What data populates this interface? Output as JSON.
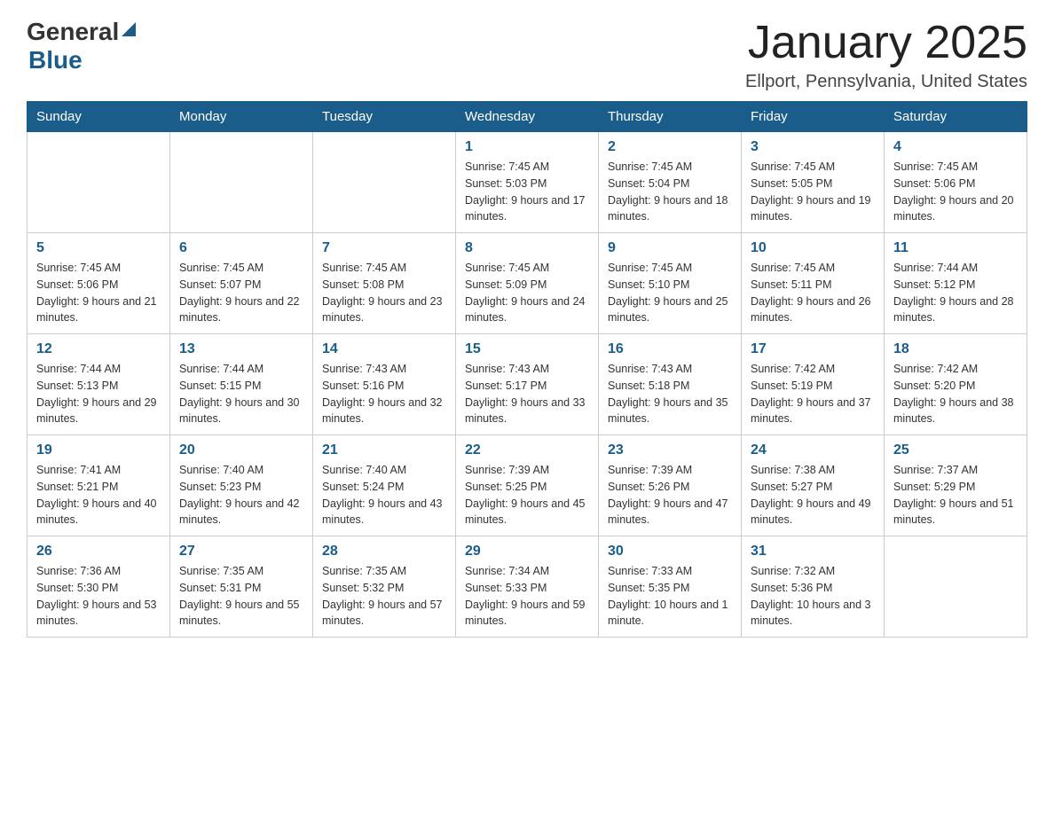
{
  "logo": {
    "general": "General",
    "blue": "Blue"
  },
  "header": {
    "title": "January 2025",
    "location": "Ellport, Pennsylvania, United States"
  },
  "days_of_week": [
    "Sunday",
    "Monday",
    "Tuesday",
    "Wednesday",
    "Thursday",
    "Friday",
    "Saturday"
  ],
  "weeks": [
    [
      {
        "day": "",
        "info": ""
      },
      {
        "day": "",
        "info": ""
      },
      {
        "day": "",
        "info": ""
      },
      {
        "day": "1",
        "info": "Sunrise: 7:45 AM\nSunset: 5:03 PM\nDaylight: 9 hours\nand 17 minutes."
      },
      {
        "day": "2",
        "info": "Sunrise: 7:45 AM\nSunset: 5:04 PM\nDaylight: 9 hours\nand 18 minutes."
      },
      {
        "day": "3",
        "info": "Sunrise: 7:45 AM\nSunset: 5:05 PM\nDaylight: 9 hours\nand 19 minutes."
      },
      {
        "day": "4",
        "info": "Sunrise: 7:45 AM\nSunset: 5:06 PM\nDaylight: 9 hours\nand 20 minutes."
      }
    ],
    [
      {
        "day": "5",
        "info": "Sunrise: 7:45 AM\nSunset: 5:06 PM\nDaylight: 9 hours\nand 21 minutes."
      },
      {
        "day": "6",
        "info": "Sunrise: 7:45 AM\nSunset: 5:07 PM\nDaylight: 9 hours\nand 22 minutes."
      },
      {
        "day": "7",
        "info": "Sunrise: 7:45 AM\nSunset: 5:08 PM\nDaylight: 9 hours\nand 23 minutes."
      },
      {
        "day": "8",
        "info": "Sunrise: 7:45 AM\nSunset: 5:09 PM\nDaylight: 9 hours\nand 24 minutes."
      },
      {
        "day": "9",
        "info": "Sunrise: 7:45 AM\nSunset: 5:10 PM\nDaylight: 9 hours\nand 25 minutes."
      },
      {
        "day": "10",
        "info": "Sunrise: 7:45 AM\nSunset: 5:11 PM\nDaylight: 9 hours\nand 26 minutes."
      },
      {
        "day": "11",
        "info": "Sunrise: 7:44 AM\nSunset: 5:12 PM\nDaylight: 9 hours\nand 28 minutes."
      }
    ],
    [
      {
        "day": "12",
        "info": "Sunrise: 7:44 AM\nSunset: 5:13 PM\nDaylight: 9 hours\nand 29 minutes."
      },
      {
        "day": "13",
        "info": "Sunrise: 7:44 AM\nSunset: 5:15 PM\nDaylight: 9 hours\nand 30 minutes."
      },
      {
        "day": "14",
        "info": "Sunrise: 7:43 AM\nSunset: 5:16 PM\nDaylight: 9 hours\nand 32 minutes."
      },
      {
        "day": "15",
        "info": "Sunrise: 7:43 AM\nSunset: 5:17 PM\nDaylight: 9 hours\nand 33 minutes."
      },
      {
        "day": "16",
        "info": "Sunrise: 7:43 AM\nSunset: 5:18 PM\nDaylight: 9 hours\nand 35 minutes."
      },
      {
        "day": "17",
        "info": "Sunrise: 7:42 AM\nSunset: 5:19 PM\nDaylight: 9 hours\nand 37 minutes."
      },
      {
        "day": "18",
        "info": "Sunrise: 7:42 AM\nSunset: 5:20 PM\nDaylight: 9 hours\nand 38 minutes."
      }
    ],
    [
      {
        "day": "19",
        "info": "Sunrise: 7:41 AM\nSunset: 5:21 PM\nDaylight: 9 hours\nand 40 minutes."
      },
      {
        "day": "20",
        "info": "Sunrise: 7:40 AM\nSunset: 5:23 PM\nDaylight: 9 hours\nand 42 minutes."
      },
      {
        "day": "21",
        "info": "Sunrise: 7:40 AM\nSunset: 5:24 PM\nDaylight: 9 hours\nand 43 minutes."
      },
      {
        "day": "22",
        "info": "Sunrise: 7:39 AM\nSunset: 5:25 PM\nDaylight: 9 hours\nand 45 minutes."
      },
      {
        "day": "23",
        "info": "Sunrise: 7:39 AM\nSunset: 5:26 PM\nDaylight: 9 hours\nand 47 minutes."
      },
      {
        "day": "24",
        "info": "Sunrise: 7:38 AM\nSunset: 5:27 PM\nDaylight: 9 hours\nand 49 minutes."
      },
      {
        "day": "25",
        "info": "Sunrise: 7:37 AM\nSunset: 5:29 PM\nDaylight: 9 hours\nand 51 minutes."
      }
    ],
    [
      {
        "day": "26",
        "info": "Sunrise: 7:36 AM\nSunset: 5:30 PM\nDaylight: 9 hours\nand 53 minutes."
      },
      {
        "day": "27",
        "info": "Sunrise: 7:35 AM\nSunset: 5:31 PM\nDaylight: 9 hours\nand 55 minutes."
      },
      {
        "day": "28",
        "info": "Sunrise: 7:35 AM\nSunset: 5:32 PM\nDaylight: 9 hours\nand 57 minutes."
      },
      {
        "day": "29",
        "info": "Sunrise: 7:34 AM\nSunset: 5:33 PM\nDaylight: 9 hours\nand 59 minutes."
      },
      {
        "day": "30",
        "info": "Sunrise: 7:33 AM\nSunset: 5:35 PM\nDaylight: 10 hours\nand 1 minute."
      },
      {
        "day": "31",
        "info": "Sunrise: 7:32 AM\nSunset: 5:36 PM\nDaylight: 10 hours\nand 3 minutes."
      },
      {
        "day": "",
        "info": ""
      }
    ]
  ]
}
